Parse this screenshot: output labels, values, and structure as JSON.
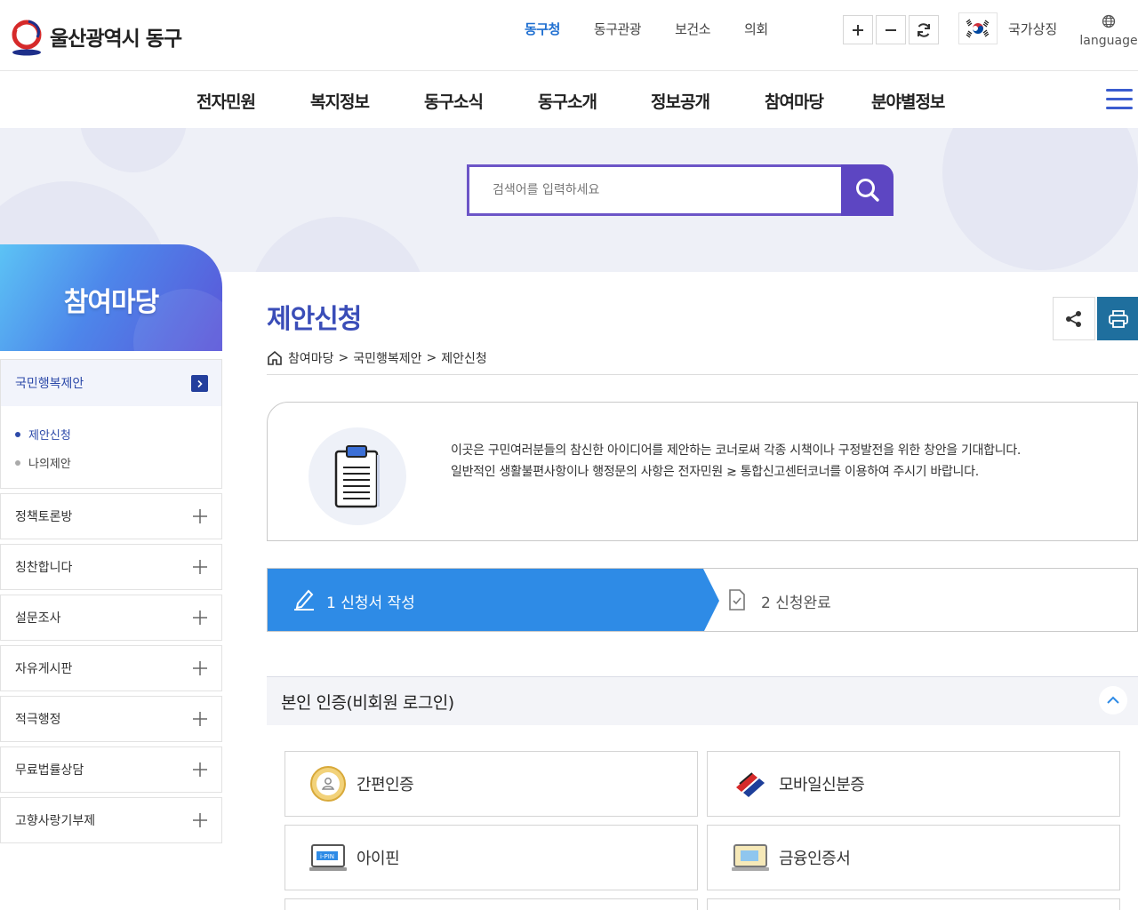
{
  "header": {
    "site_name": "울산광역시 동구",
    "util_links": [
      "동구청",
      "동구관광",
      "보건소",
      "의회"
    ],
    "national_symbol_label": "국가상징",
    "language_label": "language",
    "zoom_icons": [
      "plus-icon",
      "minus-icon",
      "refresh-icon"
    ]
  },
  "gnb": {
    "items": [
      "전자민원",
      "복지정보",
      "동구소식",
      "동구소개",
      "정보공개",
      "참여마당",
      "분야별정보"
    ]
  },
  "search": {
    "placeholder": "검색어를 입력하세요"
  },
  "lnb": {
    "title": "참여마당",
    "active_group": "국민행복제안",
    "sub_items": [
      {
        "label": "제안신청",
        "active": true
      },
      {
        "label": "나의제안",
        "active": false
      }
    ],
    "groups": [
      "정책토론방",
      "칭찬합니다",
      "설문조사",
      "자유게시판",
      "적극행정",
      "무료법률상담",
      "고향사랑기부제"
    ]
  },
  "content": {
    "title": "제안신청",
    "breadcrumb": [
      "참여마당",
      "국민행복제안",
      "제안신청"
    ],
    "intro": {
      "line1": "이곳은 구민여러분들의 참신한 아이디어를 제안하는 코너로써 각종 시책이나 구정발전을 위한 창안을 기대합니다.",
      "line2": "일반적인 생활불편사항이나 행정문의 사항은 전자민원 ≳ 통합신고센터코너를 이용하여 주시기 바랍니다."
    },
    "steps": [
      {
        "label": "1 신청서 작성",
        "active": true
      },
      {
        "label": "2 신청완료",
        "active": false
      }
    ],
    "auth": {
      "title": "본인 인증(비회원 로그인)",
      "options": [
        "간편인증",
        "모바일신분증",
        "아이핀",
        "금융인증서"
      ]
    }
  },
  "colors": {
    "accent_blue": "#2e8be6",
    "search_purple": "#5d46c2",
    "title_blue": "#3a4db8",
    "lnb_navy": "#243f9d"
  }
}
